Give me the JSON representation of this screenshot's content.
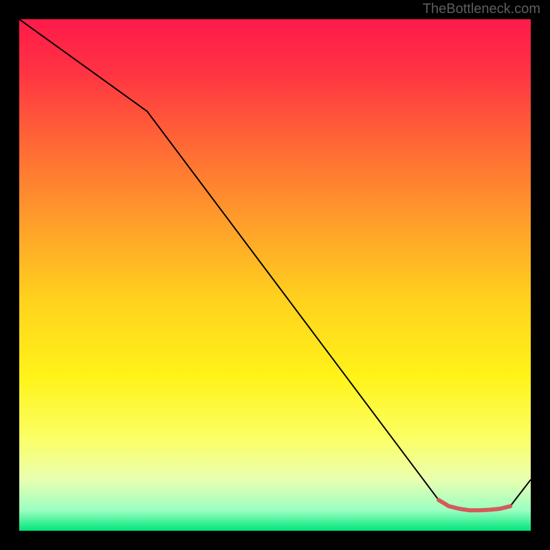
{
  "attribution": "TheBottleneck.com",
  "chart_data": {
    "type": "line",
    "title": "",
    "xlabel": "",
    "ylabel": "",
    "xlim": [
      0,
      100
    ],
    "ylim": [
      0,
      100
    ],
    "grid": false,
    "background_gradient": {
      "stops": [
        {
          "offset": 0.0,
          "color": "#ff1a4a"
        },
        {
          "offset": 0.1,
          "color": "#ff3243"
        },
        {
          "offset": 0.25,
          "color": "#ff6a35"
        },
        {
          "offset": 0.4,
          "color": "#ff9f2a"
        },
        {
          "offset": 0.55,
          "color": "#ffd21d"
        },
        {
          "offset": 0.7,
          "color": "#fff319"
        },
        {
          "offset": 0.82,
          "color": "#fcff66"
        },
        {
          "offset": 0.9,
          "color": "#e9ffb0"
        },
        {
          "offset": 0.96,
          "color": "#9bffc2"
        },
        {
          "offset": 1.0,
          "color": "#00e57a"
        }
      ]
    },
    "series": [
      {
        "name": "main-line",
        "color": "#000000",
        "width": 2.0,
        "x": [
          0,
          25,
          82,
          84,
          86,
          88,
          90,
          92,
          94,
          96,
          100
        ],
        "y": [
          100,
          82,
          6,
          4.8,
          4.3,
          4.0,
          4.0,
          4.1,
          4.3,
          4.8,
          10
        ]
      },
      {
        "name": "highlight-flat",
        "color": "#d55a5a",
        "width": 6.0,
        "linecap": "round",
        "x": [
          82,
          84,
          86,
          88,
          90,
          92,
          94,
          96
        ],
        "y": [
          6.0,
          4.8,
          4.3,
          4.0,
          4.0,
          4.1,
          4.3,
          4.8
        ]
      }
    ]
  }
}
